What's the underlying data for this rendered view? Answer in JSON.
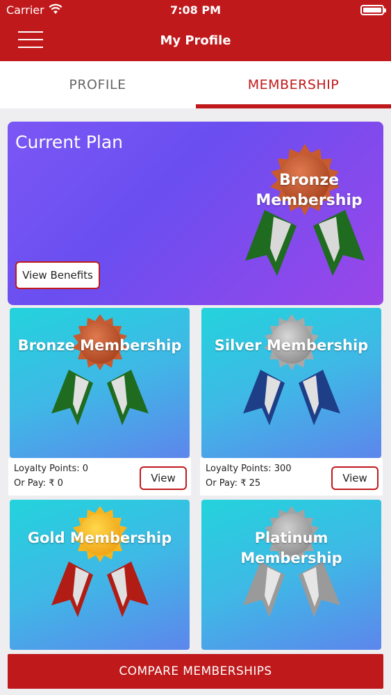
{
  "status_bar": {
    "carrier": "Carrier",
    "time": "7:08 PM"
  },
  "nav": {
    "title": "My Profile"
  },
  "tabs": [
    {
      "label": "PROFILE",
      "active": false
    },
    {
      "label": "MEMBERSHIP",
      "active": true
    }
  ],
  "current_plan": {
    "title": "Current Plan",
    "badge_label": "Bronze Membership",
    "view_benefits_label": "View Benefits"
  },
  "memberships": [
    {
      "name": "Bronze Membership",
      "loyalty_points": "Loyalty Points: 0",
      "or_pay": "Or Pay: ₹ 0",
      "view_label": "View"
    },
    {
      "name": "Silver Membership",
      "loyalty_points": "Loyalty Points: 300",
      "or_pay": "Or Pay: ₹ 25",
      "view_label": "View"
    },
    {
      "name": "Gold Membership"
    },
    {
      "name": "Platinum Membership"
    }
  ],
  "compare_button_label": "COMPARE MEMBERSHIPS",
  "colors": {
    "brand_red": "#c0191b",
    "current_plan_gradient": [
      "#7b57f5",
      "#9b46e9"
    ],
    "card_gradient": [
      "#23d3dc",
      "#5d86ec"
    ]
  },
  "icons": [
    "wifi-icon",
    "battery-icon",
    "menu-icon",
    "bronze-medal-icon",
    "silver-medal-icon",
    "gold-medal-icon",
    "platinum-medal-icon"
  ]
}
